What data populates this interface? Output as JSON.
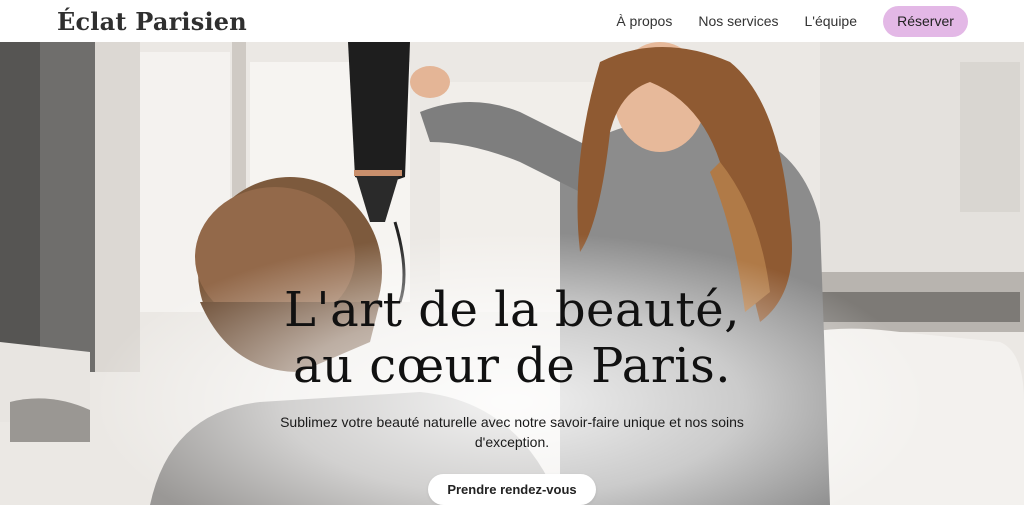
{
  "header": {
    "brand": "Éclat Parisien",
    "nav": [
      {
        "label": "À propos"
      },
      {
        "label": "Nos services"
      },
      {
        "label": "L'équipe"
      }
    ],
    "reserve_label": "Réserver"
  },
  "hero": {
    "title_line1": "L'art de la beauté,",
    "title_line2": "au cœur de Paris.",
    "subtitle": "Sublimez votre beauté naturelle avec notre savoir-faire unique et nos soins d'exception.",
    "cta_label": "Prendre rendez-vous"
  },
  "colors": {
    "accent": "#e3b8e6",
    "text": "#111111",
    "background": "#ffffff"
  }
}
